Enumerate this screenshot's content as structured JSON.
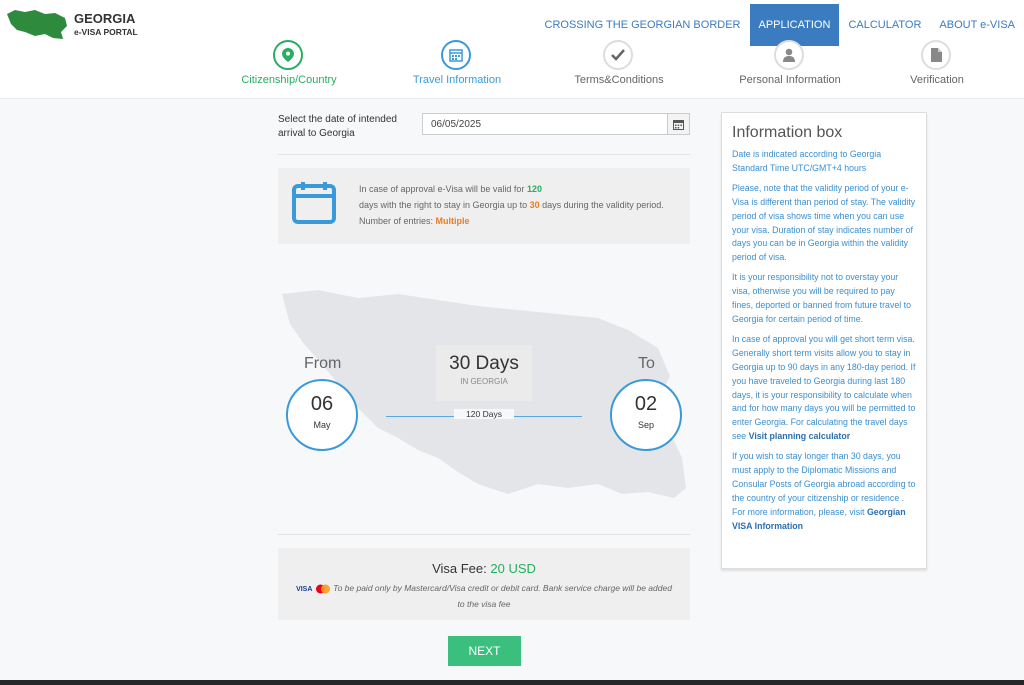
{
  "brand": {
    "title": "GEORGIA",
    "subtitle": "e-VISA PORTAL"
  },
  "nav": [
    "CROSSING THE GEORGIAN BORDER",
    "APPLICATION",
    "CALCULATOR",
    "ABOUT e-VISA"
  ],
  "steps": [
    "Citizenship/Country",
    "Travel Information",
    "Terms&Conditions",
    "Personal Information",
    "Verification"
  ],
  "arrival": {
    "label": "Select the date of intended arrival to Georgia",
    "value": "06/05/2025"
  },
  "validity": {
    "line1_pre": "In case of approval e-Visa will be valid for",
    "valid_days": "120",
    "line2_pre": "days with the right to stay in Georgia up to",
    "stay_days": "30",
    "line2_post": "days during the validity period.",
    "entries_label": "Number of entries:",
    "entries_value": "Multiple"
  },
  "stay": {
    "from_label": "From",
    "from_day": "06",
    "from_month": "May",
    "to_label": "To",
    "to_day": "02",
    "to_month": "Sep",
    "days_title": "30 Days",
    "days_sub": "IN GEORGIA",
    "validity_days": "120 Days"
  },
  "fee": {
    "label": "Visa Fee:",
    "amount": "20 USD",
    "note": "To be paid only by Mastercard/Visa credit or debit card. Bank service charge will be added to the visa fee",
    "visa_mark": "VISA"
  },
  "next_label": "NEXT",
  "info": {
    "title": "Information box",
    "p1": "Date is indicated according to Georgia Standard Time UTC/GMT+4 hours",
    "p2": "Please, note that the validity period of your e-Visa is different than period of stay. The validity period of visa shows time when you can use your visa. Duration of stay indicates number of days you can be in Georgia within the validity period of visa.",
    "p3": "It is your responsibility not to overstay your visa, otherwise you will be required to pay fines, deported or banned from future travel to Georgia for certain period of time.",
    "p4": "In case of approval you will get short term visa. Generally short term visits allow you to stay in Georgia up to 90 days in any 180-day period. If you have traveled to Georgia during last 180 days, it is your responsibility to calculate when and for how many days you will be permitted to enter Georgia. For calculating the travel days see",
    "p4_link": "Visit planning calculator",
    "p5": "If you wish to stay longer than 30 days, you must apply to the Diplomatic Missions and Consular Posts of Georgia abroad according to the country of your citizenship or residence . For more information, please, visit",
    "p5_link": "Georgian VISA Information"
  },
  "colors": {
    "primary": "#3b7cc0",
    "green": "#27ae60",
    "orange": "#e67e22",
    "button": "#3bbf7f"
  }
}
